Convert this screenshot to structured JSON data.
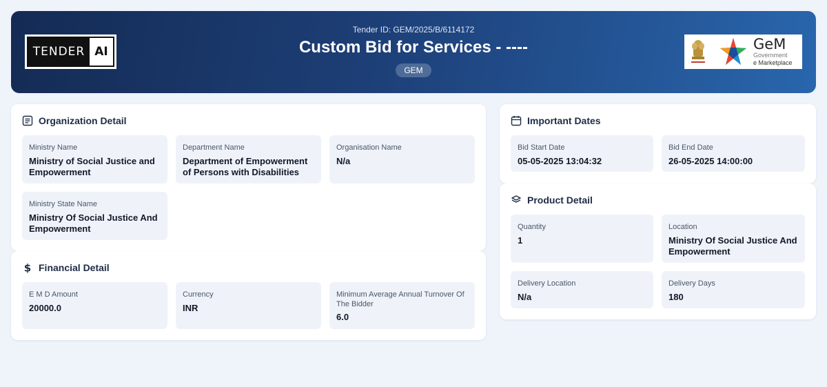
{
  "header": {
    "logo_left": {
      "word": "TENDER",
      "accent": "AI"
    },
    "tender_id": "Tender ID: GEM/2025/B/6114172",
    "title": "Custom Bid for Services - ----",
    "badge": "GEM",
    "logo_right": {
      "brand": "GeM",
      "line1": "Government",
      "line2": "e Marketplace"
    }
  },
  "organization": {
    "title": "Organization Detail",
    "icon": "document-list-icon",
    "fields": [
      {
        "label": "Ministry Name",
        "value": "Ministry of Social Justice and Empowerment"
      },
      {
        "label": "Department Name",
        "value": "Department of Empowerment of Persons with Disabilities"
      },
      {
        "label": "Organisation Name",
        "value": "N/a"
      },
      {
        "label": "Ministry State Name",
        "value": "Ministry Of Social Justice And Empowerment"
      }
    ]
  },
  "financial": {
    "title": "Financial Detail",
    "icon": "dollar-icon",
    "fields": [
      {
        "label": "E M D Amount",
        "value": "20000.0"
      },
      {
        "label": "Currency",
        "value": "INR"
      },
      {
        "label": "Minimum Average Annual Turnover Of The Bidder",
        "value": "6.0"
      }
    ]
  },
  "dates": {
    "title": "Important Dates",
    "icon": "calendar-icon",
    "fields": [
      {
        "label": "Bid Start Date",
        "value": "05-05-2025 13:04:32"
      },
      {
        "label": "Bid End Date",
        "value": "26-05-2025 14:00:00"
      }
    ]
  },
  "product": {
    "title": "Product Detail",
    "icon": "layers-icon",
    "fields": [
      {
        "label": "Quantity",
        "value": "1"
      },
      {
        "label": "Location",
        "value": "Ministry Of Social Justice And Empowerment"
      },
      {
        "label": "Delivery Location",
        "value": "N/a"
      },
      {
        "label": "Delivery Days",
        "value": "180"
      }
    ]
  },
  "colors": {
    "header_start": "#142b54",
    "header_end": "#2966ad",
    "page_bg": "#eff3fa",
    "field_bg": "#eff3f9"
  }
}
